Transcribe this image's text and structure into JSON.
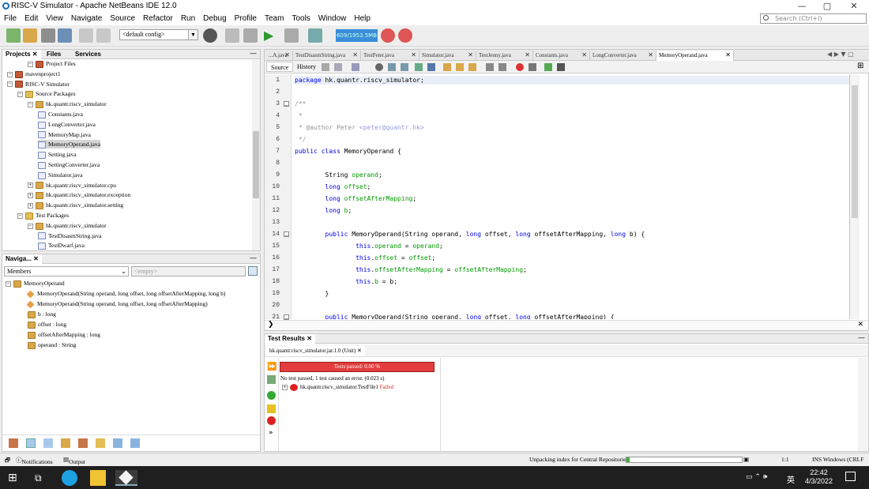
{
  "window": {
    "title": "RISC-V Simulator - Apache NetBeans IDE 12.0"
  },
  "menu": [
    "File",
    "Edit",
    "View",
    "Navigate",
    "Source",
    "Refactor",
    "Run",
    "Debug",
    "Profile",
    "Team",
    "Tools",
    "Window",
    "Help"
  ],
  "search": {
    "placeholder": "Search (Ctrl+I)"
  },
  "toolbar": {
    "config": "<default config>",
    "memory": "609/1953.5MB"
  },
  "projects": {
    "tabs": [
      "Projects",
      "Files",
      "Services"
    ],
    "tree": [
      {
        "label": "Project Files",
        "indent": 2,
        "icon": "proj"
      },
      {
        "label": "mavenproject1",
        "indent": 0,
        "icon": "proj"
      },
      {
        "label": "RISC-V Simulator",
        "indent": 0,
        "icon": "proj"
      },
      {
        "label": "Source Packages",
        "indent": 1,
        "icon": "fold"
      },
      {
        "label": "hk.quantr.riscv_simulator",
        "indent": 2,
        "icon": "pkg"
      },
      {
        "label": "Constants.java",
        "indent": 3,
        "icon": "jv"
      },
      {
        "label": "LongConverter.java",
        "indent": 3,
        "icon": "jv"
      },
      {
        "label": "MemoryMap.java",
        "indent": 3,
        "icon": "jv"
      },
      {
        "label": "MemoryOperand.java",
        "indent": 3,
        "icon": "jv",
        "selected": true
      },
      {
        "label": "Setting.java",
        "indent": 3,
        "icon": "jv"
      },
      {
        "label": "SettingConverter.java",
        "indent": 3,
        "icon": "jv"
      },
      {
        "label": "Simulator.java",
        "indent": 3,
        "icon": "jv"
      },
      {
        "label": "hk.quantr.riscv_simulator.cpu",
        "indent": 2,
        "icon": "pkg"
      },
      {
        "label": "hk.quantr.riscv_simulator.exception",
        "indent": 2,
        "icon": "pkg"
      },
      {
        "label": "hk.quantr.riscv_simulator.setting",
        "indent": 2,
        "icon": "pkg"
      },
      {
        "label": "Test Packages",
        "indent": 1,
        "icon": "fold"
      },
      {
        "label": "hk.quantr.riscv_simulator",
        "indent": 2,
        "icon": "pkg"
      },
      {
        "label": "TestDisasmString.java",
        "indent": 3,
        "icon": "jv"
      },
      {
        "label": "TestDwarf.java",
        "indent": 3,
        "icon": "jv"
      }
    ]
  },
  "navigator": {
    "title": "Naviga...",
    "filter": "Members",
    "filter2": "<empty>",
    "class": "MemoryOperand",
    "members": [
      {
        "label": "MemoryOperand(String operand, long offset, long offsetAfterMapping, long b)",
        "type": "ctor"
      },
      {
        "label": "MemoryOperand(String operand, long offset, long offsetAfterMapping)",
        "type": "ctor"
      },
      {
        "label": "b : long",
        "type": "field"
      },
      {
        "label": "offset : long",
        "type": "field"
      },
      {
        "label": "offsetAfterMapping : long",
        "type": "field"
      },
      {
        "label": "operand : String",
        "type": "field"
      }
    ]
  },
  "editor": {
    "tabs": [
      "...A.java",
      "TestDisasmString.java",
      "TestPeter.java",
      "Simulator.java",
      "TestJenny.java",
      "Constants.java",
      "LongConverter.java",
      "MemoryOperand.java"
    ],
    "modes": [
      "Source",
      "History"
    ],
    "lines": [
      {
        "n": "1",
        "text": "package hk.quantr.riscv_simulator;"
      },
      {
        "n": "2",
        "text": ""
      },
      {
        "n": "3",
        "text": "/**"
      },
      {
        "n": "4",
        "text": " *"
      },
      {
        "n": "5",
        "text": " * @author Peter <peter@quantr.hk>"
      },
      {
        "n": "6",
        "text": " */"
      },
      {
        "n": "7",
        "text": "public class MemoryOperand {"
      },
      {
        "n": "8",
        "text": ""
      },
      {
        "n": "9",
        "text": "        String operand;"
      },
      {
        "n": "10",
        "text": "        long offset;"
      },
      {
        "n": "11",
        "text": "        long offsetAfterMapping;"
      },
      {
        "n": "12",
        "text": "        long b;"
      },
      {
        "n": "13",
        "text": ""
      },
      {
        "n": "14",
        "text": "        public MemoryOperand(String operand, long offset, long offsetAfterMapping, long b) {"
      },
      {
        "n": "15",
        "text": "                this.operand = operand;"
      },
      {
        "n": "16",
        "text": "                this.offset = offset;"
      },
      {
        "n": "17",
        "text": "                this.offsetAfterMapping = offsetAfterMapping;"
      },
      {
        "n": "18",
        "text": "                this.b = b;"
      },
      {
        "n": "19",
        "text": "        }"
      },
      {
        "n": "20",
        "text": ""
      },
      {
        "n": "21",
        "text": "        public MemoryOperand(String operand, long offset, long offsetAfterMapping) {"
      }
    ]
  },
  "tests": {
    "title": "Test Results",
    "subtab": "hk.quantr.riscv_simulator.jar.1.0 (Unit)",
    "progress": "Tests passed: 0.00 %",
    "progress_value": 0,
    "summary": "No test passed, 1 test caused an error. (0.023 s)",
    "item": "hk.quantr.riscv_simulator.TestFile1",
    "item_status": "Failed"
  },
  "status": {
    "notifications": "Notifications",
    "output": "Output",
    "task": "Unpacking index for Central Repositories",
    "position": "1:1",
    "mode": "INS  Windows (CRLF"
  },
  "taskbar": {
    "time": "22:42",
    "date": "4/3/2022",
    "lang": "英"
  }
}
